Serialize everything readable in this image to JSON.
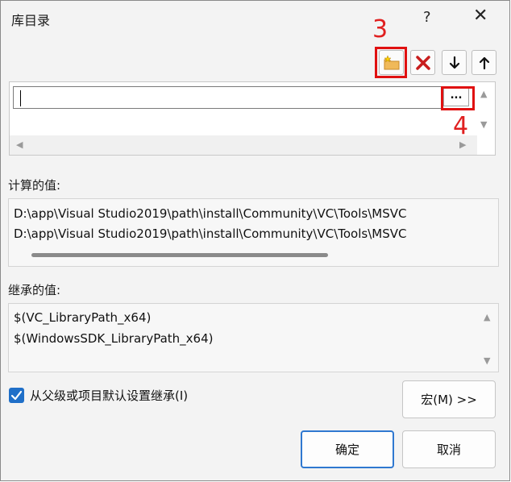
{
  "window": {
    "title": "库目录",
    "help_glyph": "?",
    "close_glyph": "✕"
  },
  "annotations": {
    "label_3": "3",
    "label_4": "4"
  },
  "toolbar": {
    "buttons": [
      {
        "name": "new-line-button",
        "icon": "folder-star-icon"
      },
      {
        "name": "delete-button",
        "icon": "red-x-icon"
      },
      {
        "name": "move-down-button",
        "icon": "arrow-down-icon"
      },
      {
        "name": "move-up-button",
        "icon": "arrow-up-icon"
      }
    ]
  },
  "editor": {
    "current_value": "",
    "browse_label": "..."
  },
  "computed": {
    "label": "计算的值:",
    "lines": [
      "D:\\app\\Visual Studio2019\\path\\install\\Community\\VC\\Tools\\MSVC",
      "D:\\app\\Visual Studio2019\\path\\install\\Community\\VC\\Tools\\MSVC"
    ]
  },
  "inherited": {
    "label": "继承的值:",
    "lines": [
      "$(VC_LibraryPath_x64)",
      "$(WindowsSDK_LibraryPath_x64)"
    ]
  },
  "inherit_checkbox": {
    "label": "从父级或项目默认设置继承(I)",
    "checked": true
  },
  "buttons": {
    "macros": "宏(M) >>",
    "ok": "确定",
    "cancel": "取消"
  },
  "colors": {
    "accent": "#1f6fc8",
    "annotation": "#e01010"
  }
}
